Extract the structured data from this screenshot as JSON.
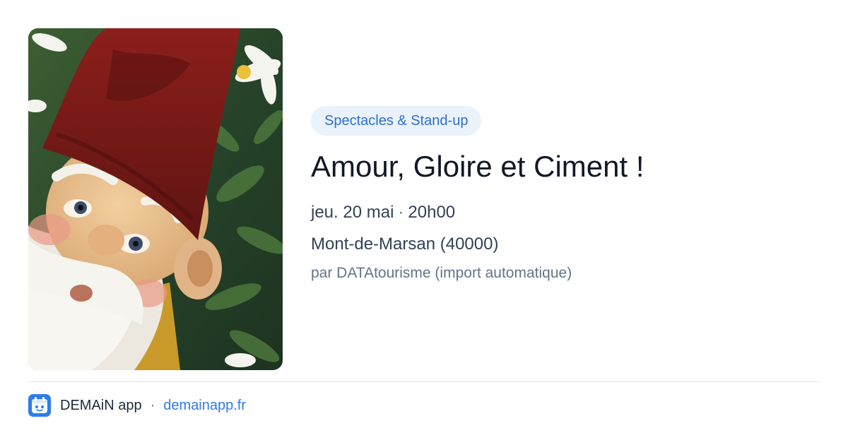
{
  "event": {
    "category": "Spectacles & Stand-up",
    "title": "Amour, Gloire et Ciment !",
    "date": "jeu. 20 mai",
    "separator": "·",
    "time": "20h00",
    "location": "Mont-de-Marsan (40000)",
    "source": "par DATAtourisme (import automatique)",
    "image_icon": "garden-gnome-photo"
  },
  "footer": {
    "app_name": "DEMAiN app",
    "separator": "·",
    "link": "demainapp.fr",
    "logo_icon": "demain-calendar-logo"
  },
  "colors": {
    "badge_bg": "#eaf2fb",
    "badge_text": "#2f6fd1",
    "link": "#2f7be0",
    "logo_bg": "#2b7de9"
  }
}
